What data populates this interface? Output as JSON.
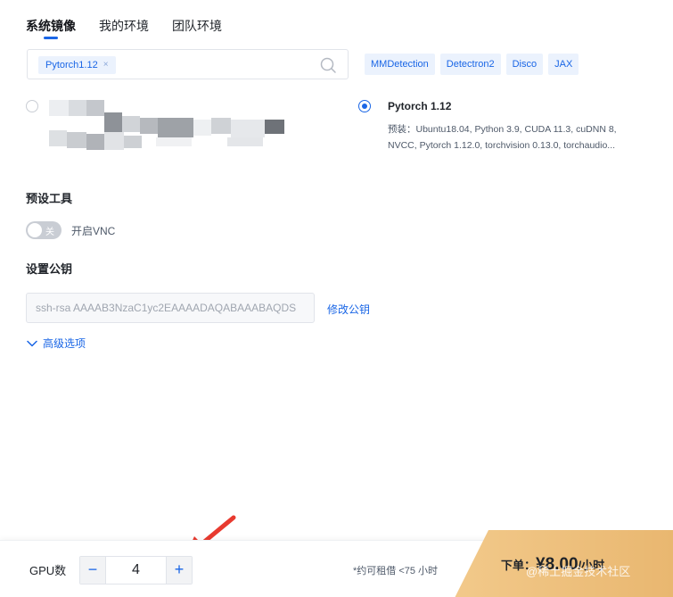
{
  "tabs": [
    {
      "label": "系统镜像",
      "active": true
    },
    {
      "label": "我的环境",
      "active": false
    },
    {
      "label": "团队环境",
      "active": false
    }
  ],
  "search": {
    "chip": "Pytorch1.12",
    "chip_remove": "×"
  },
  "quick_tags": [
    "MMDetection",
    "Detectron2",
    "Disco",
    "JAX"
  ],
  "image_card": {
    "title": "Pytorch 1.12",
    "description": "预装：Ubuntu18.04, Python 3.9, CUDA 11.3, cuDNN 8, NVCC, Pytorch 1.12.0, torchvision 0.13.0, torchaudio..."
  },
  "preset_tools": {
    "title": "预设工具",
    "toggle_state": "关",
    "toggle_label": "开启VNC"
  },
  "public_key": {
    "title": "设置公钥",
    "value": "ssh-rsa AAAAB3NzaC1yc2EAAAADAQABAAABAQDS",
    "edit_label": "修改公钥"
  },
  "advanced": {
    "label": "高级选项"
  },
  "bottom": {
    "gpu_label": "GPU数",
    "decrement": "−",
    "increment": "+",
    "gpu_count": "4",
    "estimate": "*约可租借 <75 小时",
    "order_label": "下单：",
    "order_price": "¥8.00",
    "order_unit": "/小时",
    "watermark": "@稀土掘金技术社区"
  },
  "colors": {
    "accent": "#1a66e6",
    "order_gradient_start": "#f2c98a",
    "order_gradient_end": "#e9b770"
  }
}
